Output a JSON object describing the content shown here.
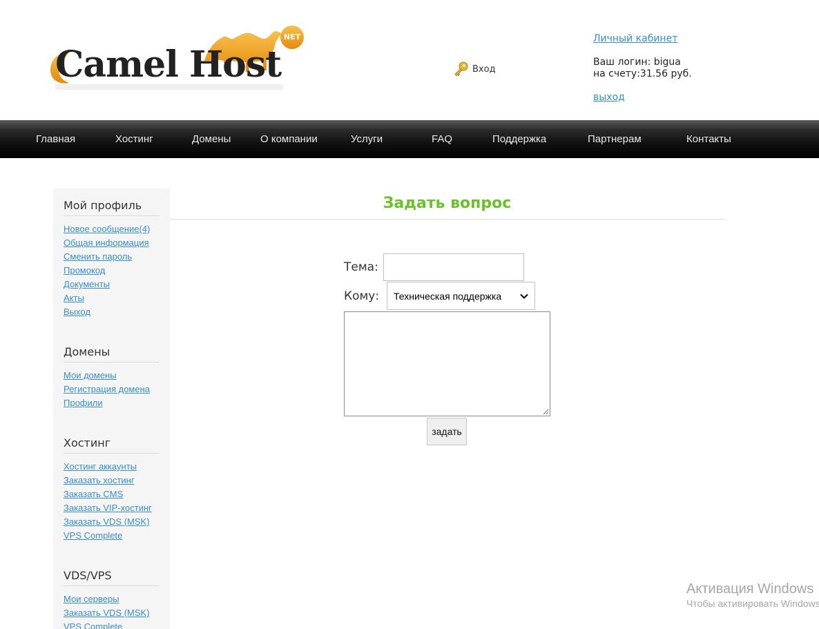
{
  "brand": {
    "name_part1": "Camel",
    "name_part2": "Host",
    "badge": "NET",
    "colors": {
      "orange": "#f0a020",
      "text_dark": "#2a2a2a"
    }
  },
  "header": {
    "login_label": "Вход",
    "login_icon": "key-icon",
    "account": {
      "cabinet_link": "Личный кабинет",
      "login_line": "Ваш логин: bigua",
      "balance_line": "на счету:31.56 руб.",
      "logout_link": "выход"
    }
  },
  "nav": {
    "items": [
      {
        "label": "Главная"
      },
      {
        "label": "Хостинг"
      },
      {
        "label": "Домены"
      },
      {
        "label": "О компании"
      },
      {
        "label": "Услуги"
      },
      {
        "label": "FAQ"
      },
      {
        "label": "Поддержка"
      },
      {
        "label": "Партнерам"
      },
      {
        "label": "Контакты"
      }
    ]
  },
  "sidebar": {
    "sections": [
      {
        "title": "Мой профиль",
        "links": [
          "Новое сообщение(4)",
          "Общая информация",
          "Сменить пароль",
          "Промокод",
          "Документы",
          "Акты",
          "Выход"
        ]
      },
      {
        "title": "Домены",
        "links": [
          "Мои домены",
          "Регистрация домена",
          "Профили"
        ]
      },
      {
        "title": "Хостинг",
        "links": [
          "Хостинг аккаунты",
          "Заказать хостинг",
          "Заказать CMS",
          "Заказать VIP-хостинг",
          "Заказать VDS (MSK)",
          "VPS Complete"
        ]
      },
      {
        "title": "VDS/VPS",
        "links": [
          "Мои серверы",
          "Заказать VDS (MSK)",
          "VPS Complete"
        ]
      }
    ]
  },
  "form": {
    "title": "Задать вопрос",
    "topic_label": "Тема:",
    "topic_value": "",
    "to_label": "Кому:",
    "to_selected": "Техническая поддержка",
    "message_value": "",
    "submit_label": "задать",
    "title_color": "#6cc02a"
  },
  "watermark": {
    "title": "Активация Windows",
    "subtitle": "Чтобы активировать Windows"
  }
}
